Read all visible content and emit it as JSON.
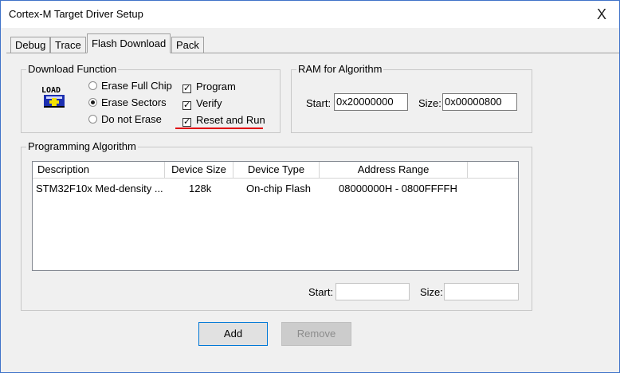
{
  "window": {
    "title": "Cortex-M Target Driver Setup",
    "close_glyph": "X"
  },
  "tabs": [
    {
      "label": "Debug",
      "active": false
    },
    {
      "label": "Trace",
      "active": false
    },
    {
      "label": "Flash Download",
      "active": true
    },
    {
      "label": "Pack",
      "active": false
    }
  ],
  "download_function": {
    "title": "Download Function",
    "icon": "load-icon",
    "radios": [
      {
        "label": "Erase Full Chip",
        "selected": false
      },
      {
        "label": "Erase Sectors",
        "selected": true
      },
      {
        "label": "Do not Erase",
        "selected": false
      }
    ],
    "checks": [
      {
        "label": "Program",
        "checked": true
      },
      {
        "label": "Verify",
        "checked": true
      },
      {
        "label": "Reset and Run",
        "checked": true
      }
    ],
    "highlight_color": "#e0000a"
  },
  "ram": {
    "title": "RAM for Algorithm",
    "start_label": "Start:",
    "start_value": "0x20000000",
    "size_label": "Size:",
    "size_value": "0x00000800"
  },
  "programming": {
    "title": "Programming Algorithm",
    "columns": [
      "Description",
      "Device Size",
      "Device Type",
      "Address Range"
    ],
    "rows": [
      {
        "description": "STM32F10x Med-density ...",
        "device_size": "128k",
        "device_type": "On-chip Flash",
        "address_range": "08000000H - 0800FFFFH"
      }
    ],
    "start_label": "Start:",
    "start_value": "",
    "size_label": "Size:",
    "size_value": ""
  },
  "buttons": {
    "add": "Add",
    "remove": "Remove"
  }
}
